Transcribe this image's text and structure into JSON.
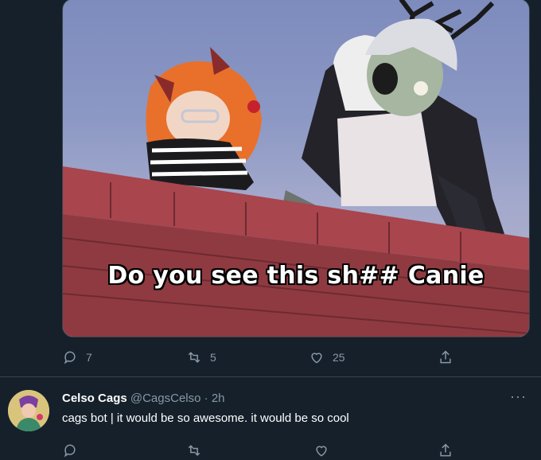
{
  "media": {
    "caption": "Do you see this sh## Canie"
  },
  "tweet1": {
    "reply_count": "7",
    "retweet_count": "5",
    "like_count": "25"
  },
  "tweet2": {
    "display_name": "Celso Cags",
    "handle": "@CagsCelso",
    "separator": "·",
    "time": "2h",
    "more": "···",
    "text": "cags bot | it would be so awesome. it would be so cool"
  },
  "colors": {
    "background": "#15202b",
    "secondary_text": "#8899a6",
    "divider": "#38444d"
  },
  "icons": [
    "reply-icon",
    "retweet-icon",
    "like-icon",
    "share-icon",
    "more-icon"
  ]
}
